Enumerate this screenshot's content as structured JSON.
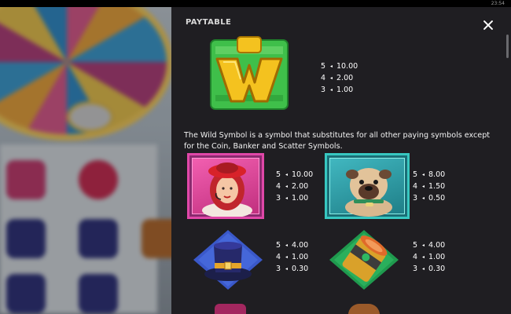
{
  "status_bar": {
    "clock": "23:54"
  },
  "panel": {
    "title": "PAYTABLE",
    "close_icon": "close-icon"
  },
  "wild": {
    "icon": "wild-w-icon",
    "letter": "W",
    "pays": [
      {
        "count": "5",
        "value": "10.00"
      },
      {
        "count": "4",
        "value": "2.00"
      },
      {
        "count": "3",
        "value": "1.00"
      }
    ]
  },
  "wild_description": "The Wild Symbol is a symbol that substitutes for all other paying symbols except for the Coin, Banker and Scatter Symbols.",
  "symbols": [
    {
      "name": "redhead-woman",
      "icon": "redhead-woman-icon",
      "pays": [
        {
          "count": "5",
          "value": "10.00"
        },
        {
          "count": "4",
          "value": "2.00"
        },
        {
          "count": "3",
          "value": "1.00"
        }
      ]
    },
    {
      "name": "pug-dog",
      "icon": "pug-dog-icon",
      "pays": [
        {
          "count": "5",
          "value": "8.00"
        },
        {
          "count": "4",
          "value": "1.50"
        },
        {
          "count": "3",
          "value": "0.50"
        }
      ]
    },
    {
      "name": "top-hat",
      "icon": "top-hat-icon",
      "pays": [
        {
          "count": "5",
          "value": "4.00"
        },
        {
          "count": "4",
          "value": "1.00"
        },
        {
          "count": "3",
          "value": "0.30"
        }
      ]
    },
    {
      "name": "coin-roll",
      "icon": "coin-roll-icon",
      "pays": [
        {
          "count": "5",
          "value": "4.00"
        },
        {
          "count": "4",
          "value": "1.00"
        },
        {
          "count": "3",
          "value": "0.30"
        }
      ]
    }
  ],
  "colors": {
    "panel_bg": "#1f1e22",
    "pink_frame": "#e047a8",
    "teal_frame": "#37c7c0",
    "wild_green": "#3fbf4a",
    "wild_gold": "#f4c21f"
  }
}
